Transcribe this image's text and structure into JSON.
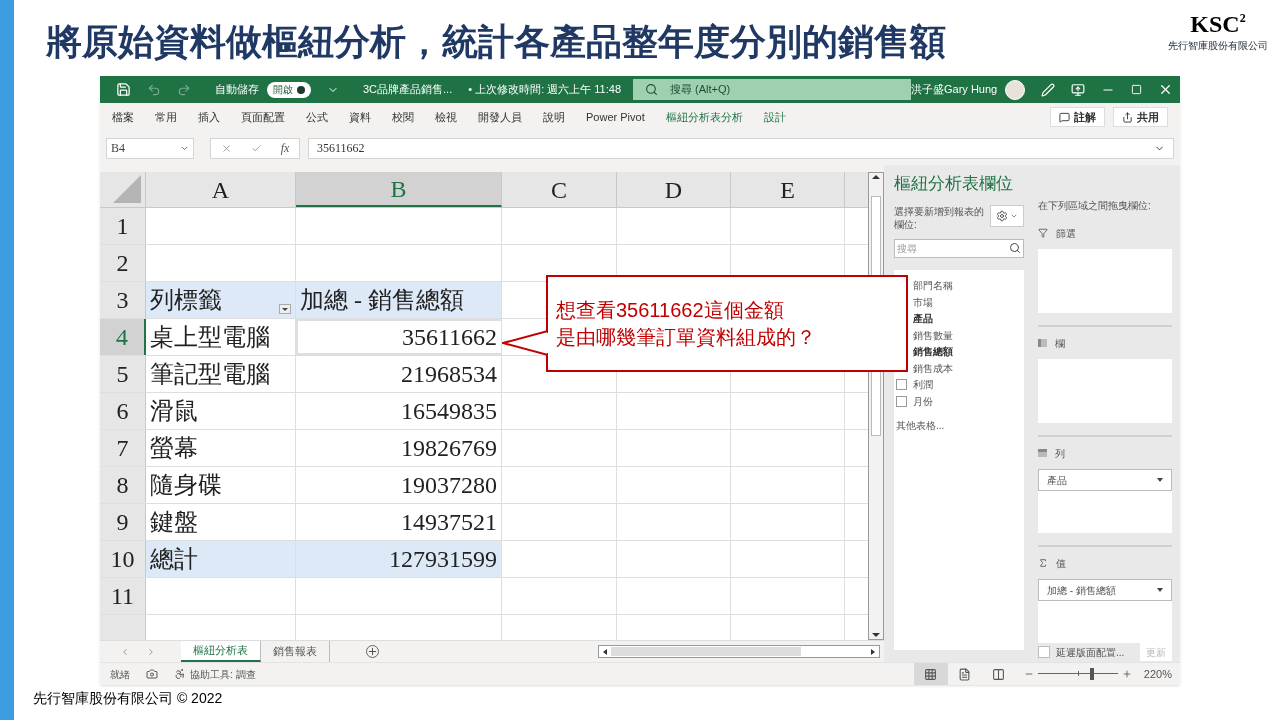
{
  "slide": {
    "title": "將原始資料做樞紐分析，統計各產品整年度分別的銷售額",
    "logo": {
      "mark": "KSC",
      "superscript": "2",
      "company": "先行智庫股份有限公司"
    },
    "footer": "先行智庫股份有限公司 © 2022"
  },
  "titlebar": {
    "autosave_label": "自動儲存",
    "autosave_toggle": {
      "label": "開啟",
      "on": true
    },
    "file_name": "3C品牌產品銷售...",
    "modified": "• 上次修改時間: 週六上午 11:48",
    "search_placeholder": "搜尋 (Alt+Q)",
    "user": "洪子盛Gary Hung"
  },
  "ribbon_tabs": [
    {
      "label": "檔案",
      "kind": "standard"
    },
    {
      "label": "常用",
      "kind": "standard"
    },
    {
      "label": "插入",
      "kind": "standard"
    },
    {
      "label": "頁面配置",
      "kind": "standard"
    },
    {
      "label": "公式",
      "kind": "standard"
    },
    {
      "label": "資料",
      "kind": "standard"
    },
    {
      "label": "校閱",
      "kind": "standard"
    },
    {
      "label": "檢視",
      "kind": "standard"
    },
    {
      "label": "開發人員",
      "kind": "standard"
    },
    {
      "label": "說明",
      "kind": "standard"
    },
    {
      "label": "Power Pivot",
      "kind": "standard"
    },
    {
      "label": "樞紐分析表分析",
      "kind": "contextual"
    },
    {
      "label": "設計",
      "kind": "contextual"
    }
  ],
  "ribbon_buttons": [
    "註解",
    "共用"
  ],
  "formula_bar": {
    "name_box": "B4",
    "function_label": "fx",
    "value": "35611662"
  },
  "sheet": {
    "columns": [
      {
        "label": "A",
        "selected": false
      },
      {
        "label": "B",
        "selected": true
      },
      {
        "label": "C",
        "selected": false
      },
      {
        "label": "D",
        "selected": false
      },
      {
        "label": "E",
        "selected": false
      }
    ],
    "rows": [
      {
        "number": "1",
        "kind": "empty",
        "selected": false
      },
      {
        "number": "2",
        "kind": "empty",
        "selected": false
      },
      {
        "number": "3",
        "kind": "header",
        "selected": false,
        "label": "列標籤",
        "value": "加總 - 銷售總額"
      },
      {
        "number": "4",
        "kind": "item",
        "selected": true,
        "label": "桌上型電腦",
        "value": "35611662"
      },
      {
        "number": "5",
        "kind": "item",
        "selected": false,
        "label": "筆記型電腦",
        "value": "21968534"
      },
      {
        "number": "6",
        "kind": "item",
        "selected": false,
        "label": "滑鼠",
        "value": "16549835"
      },
      {
        "number": "7",
        "kind": "item",
        "selected": false,
        "label": "螢幕",
        "value": "19826769"
      },
      {
        "number": "8",
        "kind": "item",
        "selected": false,
        "label": "隨身碟",
        "value": "19037280"
      },
      {
        "number": "9",
        "kind": "item",
        "selected": false,
        "label": "鍵盤",
        "value": "14937521"
      },
      {
        "number": "10",
        "kind": "total",
        "selected": false,
        "label": "總計",
        "value": "127931599"
      },
      {
        "number": "11",
        "kind": "empty",
        "selected": false
      }
    ]
  },
  "sheet_tabs": [
    {
      "label": "樞紐分析表",
      "selected": true
    },
    {
      "label": "銷售報表",
      "selected": false
    }
  ],
  "status_bar": {
    "ready": "就緒",
    "accessibility": "協助工具: 調查",
    "views": [
      {
        "kind": "normal",
        "selected": true
      },
      {
        "kind": "page_layout",
        "selected": false
      },
      {
        "kind": "page_break",
        "selected": false
      }
    ],
    "zoom": {
      "level": 0.68,
      "reading": "220%"
    }
  },
  "pivot_pane": {
    "title": "樞紐分析表欄位",
    "choose_label": "選擇要新增到報表的欄位:",
    "search_placeholder": "搜尋",
    "fields": [
      {
        "label": "部門名稱",
        "selected": false
      },
      {
        "label": "市場",
        "selected": false
      },
      {
        "label": "產品",
        "selected": true
      },
      {
        "label": "銷售數量",
        "selected": false
      },
      {
        "label": "銷售總額",
        "selected": true
      },
      {
        "label": "銷售成本",
        "selected": false
      },
      {
        "label": "利潤",
        "selected": false,
        "checked": false
      },
      {
        "label": "月份",
        "selected": false,
        "checked": false
      }
    ],
    "more_tables": "其他表格...",
    "drag_label": "在下列區域之間拖曳欄位:",
    "areas": [
      {
        "kind": "filter",
        "label": "篩選"
      },
      {
        "kind": "columns",
        "label": "欄"
      },
      {
        "kind": "rows",
        "label": "列",
        "items": [
          "產品"
        ]
      },
      {
        "kind": "values",
        "label": "值",
        "items": [
          "加總 - 銷售總額"
        ]
      }
    ],
    "defer": {
      "label": "延遲版面配置...",
      "checked": false
    },
    "update_button": {
      "label": "更新",
      "disabled": true
    }
  },
  "callout": {
    "lines": [
      "想查看35611662這個金額",
      "是由哪幾筆訂單資料組成的？"
    ]
  }
}
